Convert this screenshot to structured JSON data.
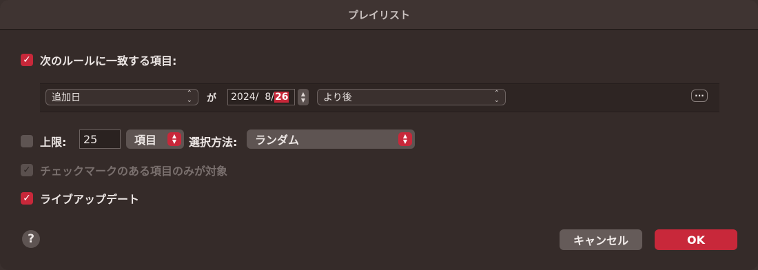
{
  "window": {
    "title": "プレイリスト"
  },
  "match": {
    "checked": true,
    "label": "次のルールに一致する項目:"
  },
  "rule": {
    "field": "追加日",
    "connector": "が",
    "date_year": "2024/",
    "date_month": "8/",
    "date_day": "26",
    "comparator": "より後",
    "more_label": "···"
  },
  "limit": {
    "checked": false,
    "label": "上限:",
    "value": "25",
    "unit": "項目",
    "selection_label": "選択方法:",
    "selection_value": "ランダム"
  },
  "checked_only": {
    "checked": true,
    "enabled": false,
    "label": "チェックマークのある項目のみが対象"
  },
  "live_update": {
    "checked": true,
    "label": "ライブアップデート"
  },
  "buttons": {
    "help": "?",
    "cancel": "キャンセル",
    "ok": "OK"
  },
  "colors": {
    "accent": "#c8283a",
    "background": "#352b29"
  },
  "icons": {
    "check": "checkmark-icon",
    "updown": "chevron-updown-icon",
    "more": "ellipsis-icon",
    "help": "question-icon"
  }
}
